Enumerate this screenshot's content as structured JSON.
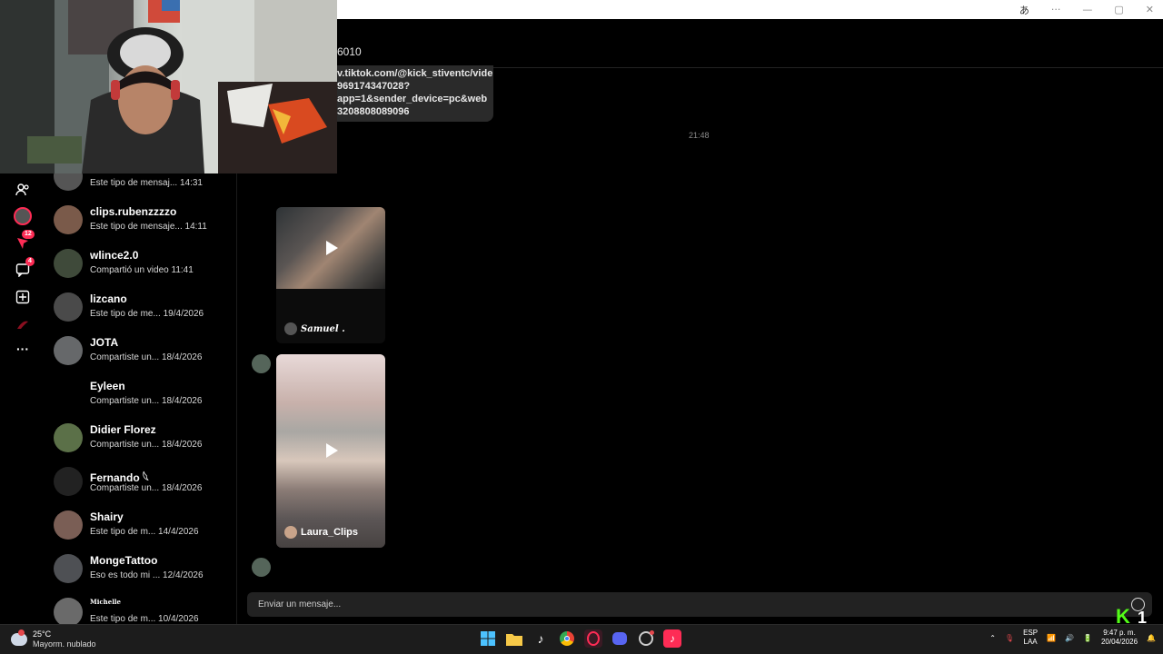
{
  "chat": {
    "header_partial": "6010",
    "link_lines": [
      "v.tiktok.com/@kick_stiventc/vide",
      "969174347028?",
      "app=1&sender_device=pc&web",
      "3208808089096"
    ],
    "timestamp": "21:48",
    "video1_author": "Samuel .",
    "video2_author": "Laura_Clips",
    "input_placeholder": "Enviar un mensaje..."
  },
  "rail": {
    "badge_activity": "12",
    "badge_messages": "4"
  },
  "conversations": [
    {
      "name": "",
      "preview": "Este tipo de mensaj...",
      "time": "14:31"
    },
    {
      "name": "clips.rubenzzzzo",
      "preview": "Este tipo de mensaje...",
      "time": "14:11"
    },
    {
      "name": "wlince2.0",
      "preview": "Compartió un video",
      "time": "11:41"
    },
    {
      "name": "lizcano",
      "preview": "Este tipo de me...",
      "time": "19/4/2026"
    },
    {
      "name": "JOTA",
      "preview": "Compartiste un...",
      "time": "18/4/2026"
    },
    {
      "name": "Eyleen",
      "preview": "Compartiste un...",
      "time": "18/4/2026"
    },
    {
      "name": "Didier Florez",
      "preview": "Compartiste un...",
      "time": "18/4/2026"
    },
    {
      "name": " Fernando 𓆩",
      "preview": "Compartiste un...",
      "time": "18/4/2026"
    },
    {
      "name": "Shairy",
      "preview": "Este tipo de m...",
      "time": "14/4/2026"
    },
    {
      "name": "MongeTattoo",
      "preview": "Eso es todo mi ...",
      "time": "12/4/2026"
    },
    {
      "name": "Michelle",
      "preview": "Este tipo de m...",
      "time": "10/4/2026"
    }
  ],
  "taskbar": {
    "weather_temp": "25°C",
    "weather_desc": "Mayorm. nublado",
    "lang_top": "ESP",
    "lang_bottom": "LAA",
    "clock_time": "9:47 p. m.",
    "clock_date": "20/04/2026"
  },
  "overlay": {
    "kick_text": "K",
    "kick_number": "1"
  },
  "colors": {
    "accent": "#fe2c55",
    "kick_green": "#53fc18",
    "bubble": "#2a2a2a"
  }
}
